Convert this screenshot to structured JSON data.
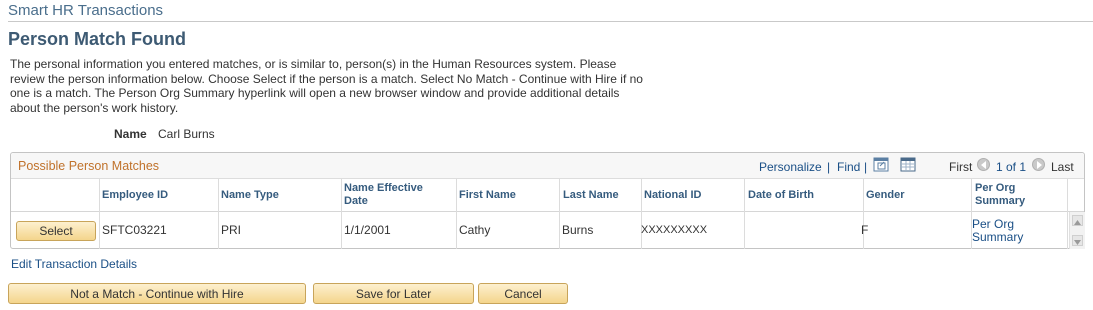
{
  "app": {
    "title": "Smart HR Transactions"
  },
  "page": {
    "title": "Person Match Found",
    "intro": "The personal information you entered matches, or is similar to, person(s) in the Human Resources system. Please review the person information below. Choose Select if the person is a match. Select No Match - Continue with Hire if no one is a match. The Person Org Summary hyperlink will open a new browser window and provide additional details about the person's work history."
  },
  "name_field": {
    "label": "Name",
    "value": "Carl Burns"
  },
  "grid": {
    "title": "Possible Person Matches",
    "toolbar": {
      "personalize": "Personalize",
      "separator": "|",
      "find": "Find",
      "first": "First",
      "range": "1 of 1",
      "last": "Last",
      "icons": [
        "view-all-icon",
        "download-icon",
        "previous-icon",
        "next-icon"
      ]
    },
    "columns": {
      "employee_id": "Employee ID",
      "name_type": "Name Type",
      "name_effective_date": "Name Effective Date",
      "first_name": "First Name",
      "last_name": "Last Name",
      "national_id": "National ID",
      "date_of_birth": "Date of Birth",
      "gender": "Gender",
      "per_org_summary": "Per Org Summary"
    },
    "rows": [
      {
        "select_label": "Select",
        "employee_id": "SFTC03221",
        "name_type": "PRI",
        "name_effective_date": "1/1/2001",
        "first_name": "Cathy",
        "last_name": "Burns",
        "national_id": "XXXXXXXXX",
        "date_of_birth": "",
        "gender": "F",
        "per_org_summary": "Per Org Summary"
      }
    ]
  },
  "links": {
    "edit_transaction": "Edit Transaction Details"
  },
  "actions": {
    "not_a_match": "Not a Match - Continue with Hire",
    "save_for_later": "Save for Later",
    "cancel": "Cancel"
  },
  "colors": {
    "button_bg": "#f4d58c",
    "button_border": "#c8a45a",
    "link": "#1a4f86",
    "grid_title": "#c0722b",
    "page_title": "#3d5a73"
  }
}
